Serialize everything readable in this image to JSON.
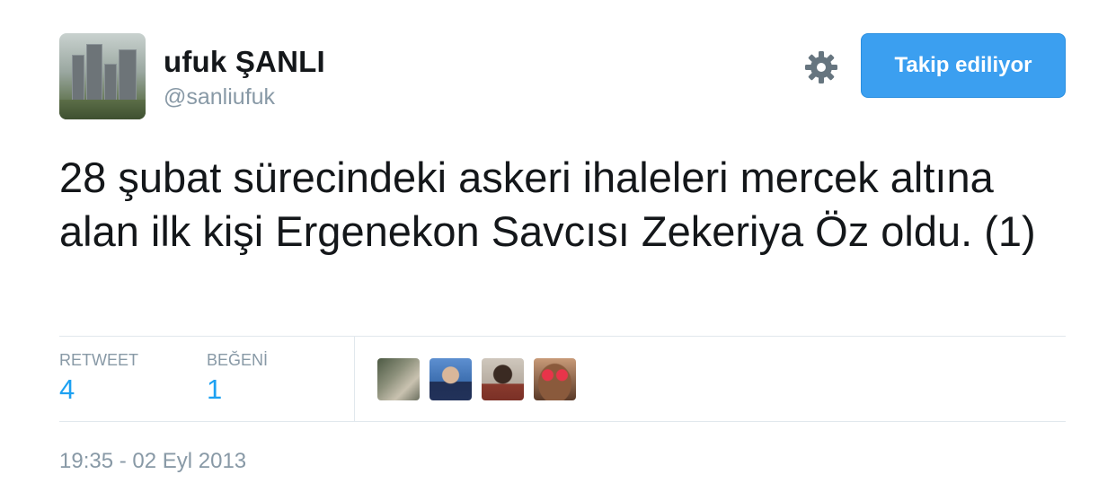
{
  "user": {
    "name": "ufuk ŞANLI",
    "handle": "@sanliufuk"
  },
  "actions": {
    "follow_label": "Takip ediliyor"
  },
  "tweet": {
    "text": "28 şubat sürecindeki askeri ihaleleri mercek altına alan ilk kişi Ergenekon Savcısı Zekeriya Öz oldu. (1)",
    "timestamp": "19:35 - 02 Eyl 2013"
  },
  "stats": {
    "retweet_label": "RETWEET",
    "retweet_count": "4",
    "like_label": "BEĞENİ",
    "like_count": "1"
  },
  "colors": {
    "accent": "#1da1f2",
    "button": "#3b9ff0",
    "muted": "#8899a6"
  }
}
